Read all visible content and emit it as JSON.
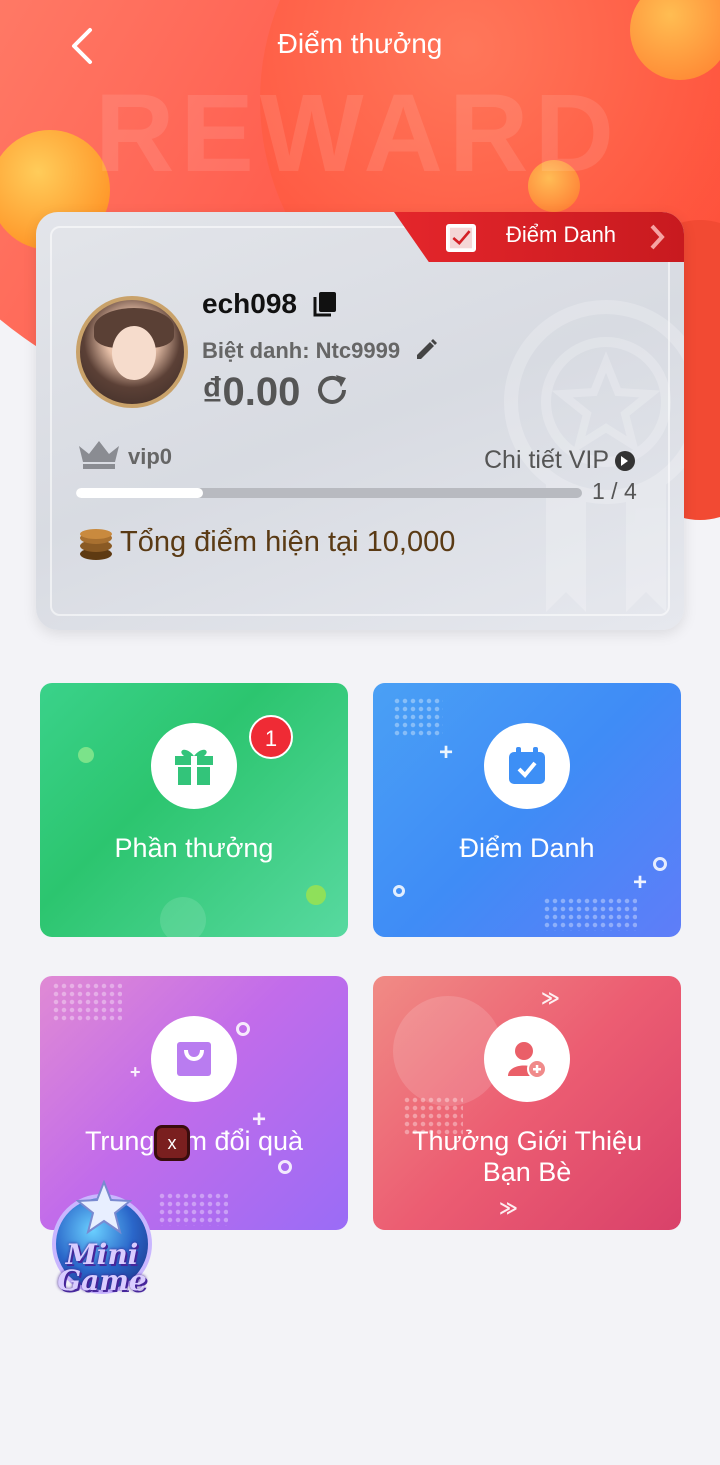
{
  "header": {
    "title": "Điểm thưởng",
    "watermark": "REWARD"
  },
  "profile": {
    "checkin_ribbon_label": "Điểm Danh",
    "username": "ech098",
    "nickname": "Biệt danh: Ntc9999",
    "balance": "₫0.00",
    "vip_level": "vip0",
    "vip_detail_label": "Chi tiết VIP",
    "vip_progress_text": "1 / 4",
    "vip_progress_fraction": 0.25,
    "total_points": "Tổng điểm hiện tại 10,000"
  },
  "tiles": {
    "rewards": {
      "label": "Phần thưởng",
      "badge": "1"
    },
    "checkin": {
      "label": "Điểm Danh"
    },
    "shop": {
      "label": "Trung tâm đổi quà"
    },
    "referral": {
      "label_line1": "Thưởng Giới Thiệu",
      "label_line2": "Bạn Bè"
    }
  },
  "floating": {
    "mini_game_label_line1": "Mini",
    "mini_game_label_line2": "Game",
    "close_label": "x"
  },
  "colors": {
    "header_red": "#ff4a3c",
    "ribbon_red": "#e4262b",
    "rewards_green": "#2cc56f",
    "checkin_blue": "#3f8cf6",
    "shop_purple": "#c26cea",
    "referral_pink": "#ec5d72"
  }
}
